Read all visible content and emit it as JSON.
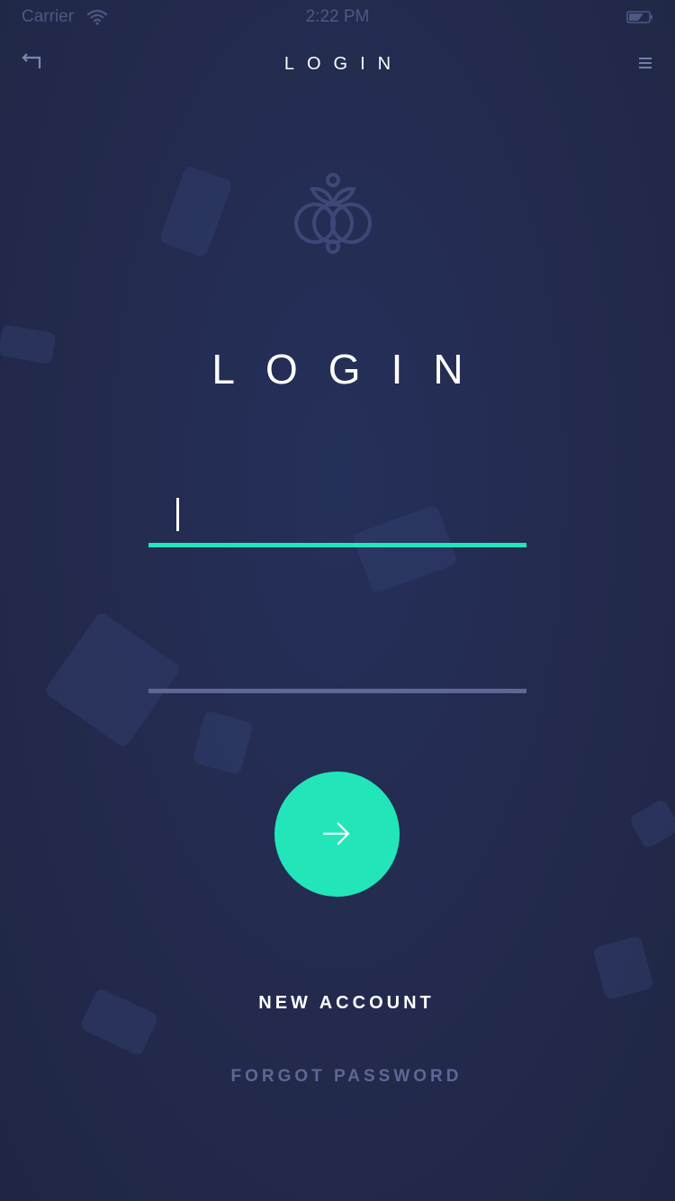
{
  "status_bar": {
    "carrier": "Carrier",
    "time": "2:22 PM"
  },
  "nav": {
    "title": "LOGIN"
  },
  "main": {
    "heading": "LOGIN",
    "username_value": "",
    "password_value": "",
    "new_account_label": "NEW ACCOUNT",
    "forgot_password_label": "FORGOT PASSWORD"
  },
  "icons": {
    "back": "back-arrow-icon",
    "menu": "hamburger-menu-icon",
    "logo": "logo-icon",
    "submit": "arrow-right-icon",
    "wifi": "wifi-icon",
    "battery": "battery-icon"
  },
  "colors": {
    "background": "#232a4b",
    "accent": "#22e6b9",
    "muted": "#5f6797",
    "status_text": "#4e5885"
  }
}
